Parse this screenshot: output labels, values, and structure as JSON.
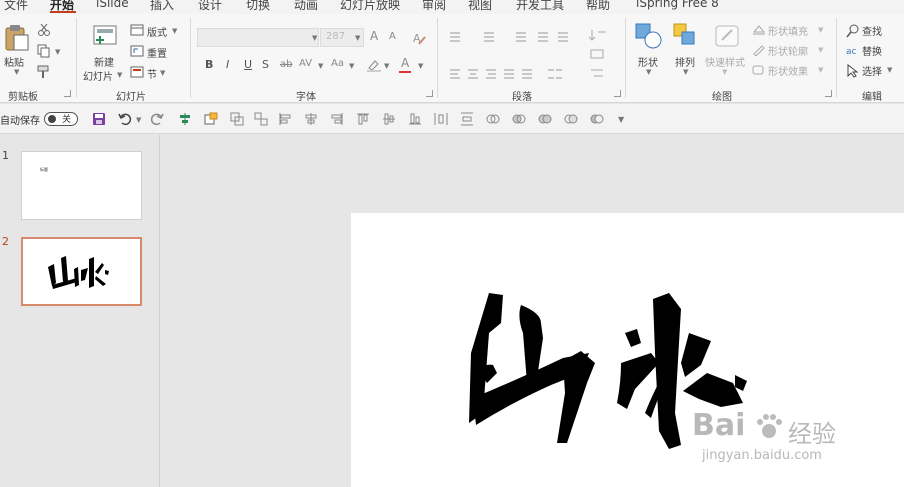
{
  "menu": {
    "tabs": [
      "文件",
      "开始",
      "iSlide",
      "插入",
      "设计",
      "切换",
      "动画",
      "幻灯片放映",
      "审阅",
      "视图",
      "开发工具",
      "帮助",
      "iSpring Free 8"
    ],
    "active": "开始"
  },
  "ribbon": {
    "clipboard": {
      "paste": "粘贴",
      "label": "剪贴板"
    },
    "slides": {
      "new_slide_line1": "新建",
      "new_slide_line2": "幻灯片",
      "layout": "版式",
      "reset": "重置",
      "section": "节",
      "label": "幻灯片"
    },
    "font": {
      "size": "287",
      "label": "字体",
      "bold": "B",
      "italic": "I",
      "underline": "U",
      "shadow": "S",
      "strike": "ab",
      "spacing": "AV",
      "case": "Aa",
      "grow": "A",
      "shrink": "A",
      "color": "A"
    },
    "paragraph": {
      "label": "段落"
    },
    "drawing": {
      "shapes": "形状",
      "arrange": "排列",
      "quick_styles": "快速样式",
      "fill": "形状填充",
      "outline": "形状轮廓",
      "effects": "形状效果",
      "label": "绘图"
    },
    "editing": {
      "find": "查找",
      "replace": "替换",
      "select": "选择",
      "label": "编辑"
    }
  },
  "qat": {
    "autosave_label": "自动保存",
    "autosave_state": "关"
  },
  "thumbnails": [
    {
      "number": "1",
      "tiny_text": "标题"
    },
    {
      "number": "2",
      "content": "山水"
    }
  ],
  "watermark": {
    "brand": "Bai",
    "brand_suffix": "经验",
    "url": "jingyan.baidu.com"
  },
  "colors": {
    "accent": "#c43e1c",
    "selected_border": "#d9896c"
  }
}
